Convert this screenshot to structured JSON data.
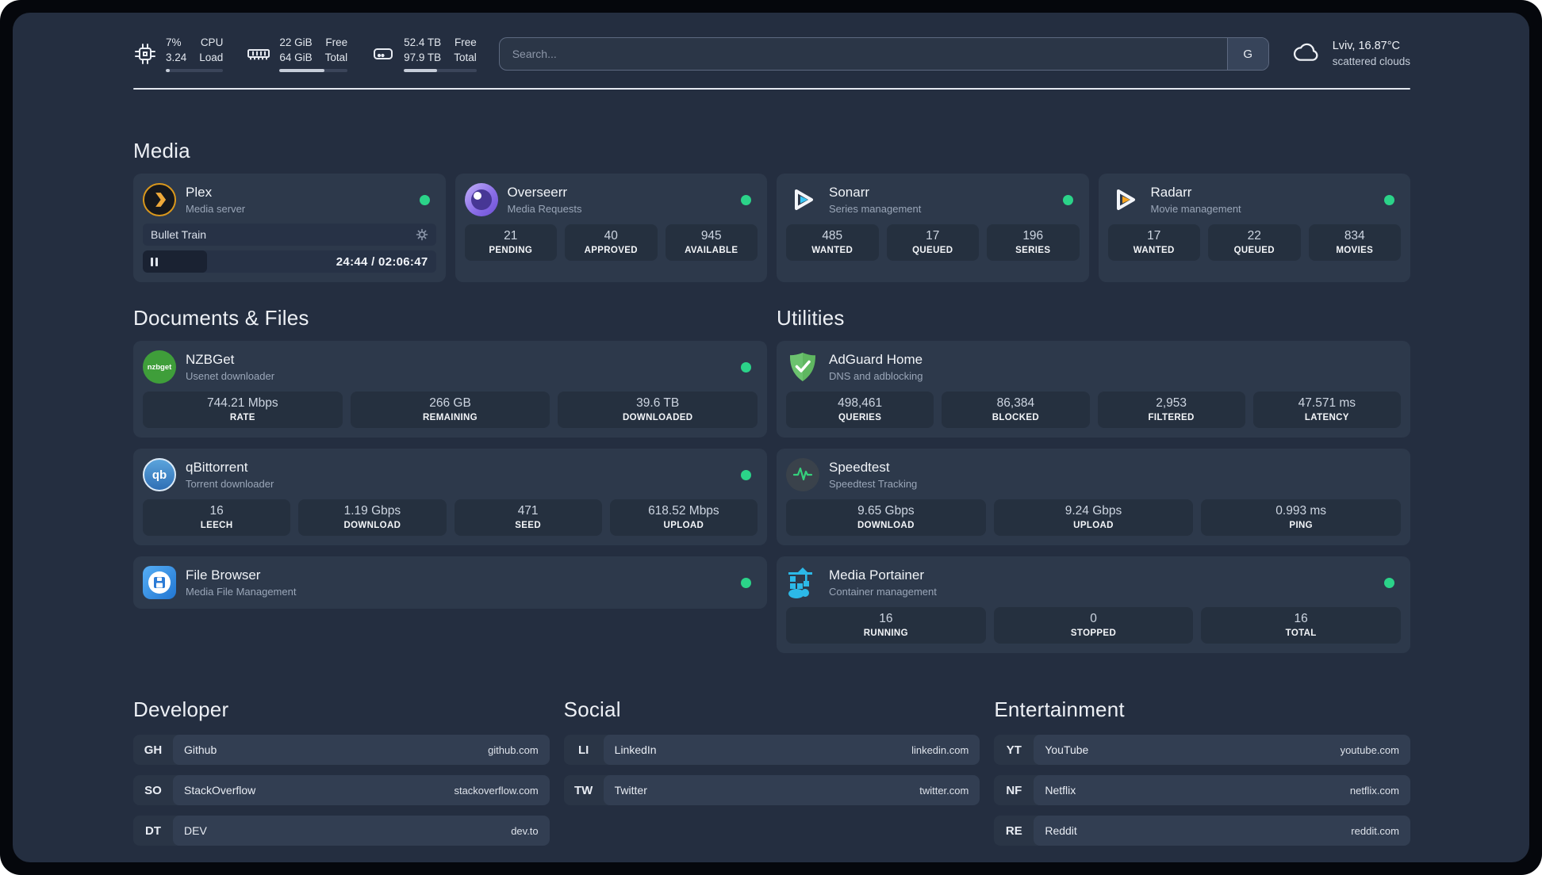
{
  "colors": {
    "status_online": "#2bd389",
    "page_bg": "#242e40",
    "card_bg": "#2d394b",
    "plex_gold": "#efa93a",
    "sonarr_cyan": "#39c5f3",
    "radarr_orange": "#f6a41f",
    "adguard_green": "#5fb760",
    "portainer_blue": "#2cb9e8"
  },
  "header": {
    "stats": [
      {
        "icon": "cpu-icon",
        "values": [
          "7%",
          "3.24"
        ],
        "labels": [
          "CPU",
          "Load"
        ],
        "progress": 7
      },
      {
        "icon": "memory-icon",
        "values": [
          "22 GiB",
          "64 GiB"
        ],
        "labels": [
          "Free",
          "Total"
        ],
        "progress": 66
      },
      {
        "icon": "disk-icon",
        "values": [
          "52.4 TB",
          "97.9 TB"
        ],
        "labels": [
          "Free",
          "Total"
        ],
        "progress": 46
      }
    ],
    "search": {
      "placeholder": "Search...",
      "provider_label": "G"
    },
    "weather": {
      "icon": "cloud-icon",
      "location": "Lviv, 16.87°C",
      "condition": "scattered clouds"
    }
  },
  "media": {
    "title": "Media",
    "plex": {
      "icon": "plex-icon",
      "name": "Plex",
      "subtitle": "Media server",
      "status": "online",
      "player": {
        "title": "Bullet Train",
        "time": "24:44 / 02:06:47",
        "progress": 22,
        "state": "paused"
      }
    },
    "overseerr": {
      "icon": "overseerr-icon",
      "name": "Overseerr",
      "subtitle": "Media Requests",
      "status": "online",
      "stats": [
        {
          "value": "21",
          "label": "PENDING"
        },
        {
          "value": "40",
          "label": "APPROVED"
        },
        {
          "value": "945",
          "label": "AVAILABLE"
        }
      ]
    },
    "sonarr": {
      "icon": "sonarr-icon",
      "name": "Sonarr",
      "subtitle": "Series management",
      "status": "online",
      "stats": [
        {
          "value": "485",
          "label": "WANTED"
        },
        {
          "value": "17",
          "label": "QUEUED"
        },
        {
          "value": "196",
          "label": "SERIES"
        }
      ]
    },
    "radarr": {
      "icon": "radarr-icon",
      "name": "Radarr",
      "subtitle": "Movie management",
      "status": "online",
      "stats": [
        {
          "value": "17",
          "label": "WANTED"
        },
        {
          "value": "22",
          "label": "QUEUED"
        },
        {
          "value": "834",
          "label": "MOVIES"
        }
      ]
    }
  },
  "documents": {
    "title": "Documents & Files",
    "nzbget": {
      "icon": "nzbget-icon",
      "logo_text": "nzbget",
      "name": "NZBGet",
      "subtitle": "Usenet downloader",
      "status": "online",
      "stats": [
        {
          "value": "744.21 Mbps",
          "label": "RATE"
        },
        {
          "value": "266 GB",
          "label": "REMAINING"
        },
        {
          "value": "39.6 TB",
          "label": "DOWNLOADED"
        }
      ]
    },
    "qbittorrent": {
      "icon": "qbittorrent-icon",
      "logo_text": "qb",
      "name": "qBittorrent",
      "subtitle": "Torrent downloader",
      "status": "online",
      "stats": [
        {
          "value": "16",
          "label": "LEECH"
        },
        {
          "value": "1.19 Gbps",
          "label": "DOWNLOAD"
        },
        {
          "value": "471",
          "label": "SEED"
        },
        {
          "value": "618.52 Mbps",
          "label": "UPLOAD"
        }
      ]
    },
    "filebrowser": {
      "icon": "filebrowser-icon",
      "name": "File Browser",
      "subtitle": "Media File Management",
      "status": "online"
    }
  },
  "utilities": {
    "title": "Utilities",
    "adguard": {
      "icon": "adguard-icon",
      "name": "AdGuard Home",
      "subtitle": "DNS and adblocking",
      "stats": [
        {
          "value": "498,461",
          "label": "QUERIES"
        },
        {
          "value": "86,384",
          "label": "BLOCKED"
        },
        {
          "value": "2,953",
          "label": "FILTERED"
        },
        {
          "value": "47.571 ms",
          "label": "LATENCY"
        }
      ]
    },
    "speedtest": {
      "icon": "speedtest-icon",
      "name": "Speedtest",
      "subtitle": "Speedtest Tracking",
      "stats": [
        {
          "value": "9.65 Gbps",
          "label": "DOWNLOAD"
        },
        {
          "value": "9.24 Gbps",
          "label": "UPLOAD"
        },
        {
          "value": "0.993 ms",
          "label": "PING"
        }
      ]
    },
    "portainer": {
      "icon": "portainer-icon",
      "name": "Media Portainer",
      "subtitle": "Container management",
      "status": "online",
      "stats": [
        {
          "value": "16",
          "label": "RUNNING"
        },
        {
          "value": "0",
          "label": "STOPPED"
        },
        {
          "value": "16",
          "label": "TOTAL"
        }
      ]
    }
  },
  "bookmarks": {
    "developer": {
      "title": "Developer",
      "links": [
        {
          "abbr": "GH",
          "name": "Github",
          "url": "github.com"
        },
        {
          "abbr": "SO",
          "name": "StackOverflow",
          "url": "stackoverflow.com"
        },
        {
          "abbr": "DT",
          "name": "DEV",
          "url": "dev.to"
        }
      ]
    },
    "social": {
      "title": "Social",
      "links": [
        {
          "abbr": "LI",
          "name": "LinkedIn",
          "url": "linkedin.com"
        },
        {
          "abbr": "TW",
          "name": "Twitter",
          "url": "twitter.com"
        }
      ]
    },
    "entertainment": {
      "title": "Entertainment",
      "links": [
        {
          "abbr": "YT",
          "name": "YouTube",
          "url": "youtube.com"
        },
        {
          "abbr": "NF",
          "name": "Netflix",
          "url": "netflix.com"
        },
        {
          "abbr": "RE",
          "name": "Reddit",
          "url": "reddit.com"
        }
      ]
    }
  }
}
